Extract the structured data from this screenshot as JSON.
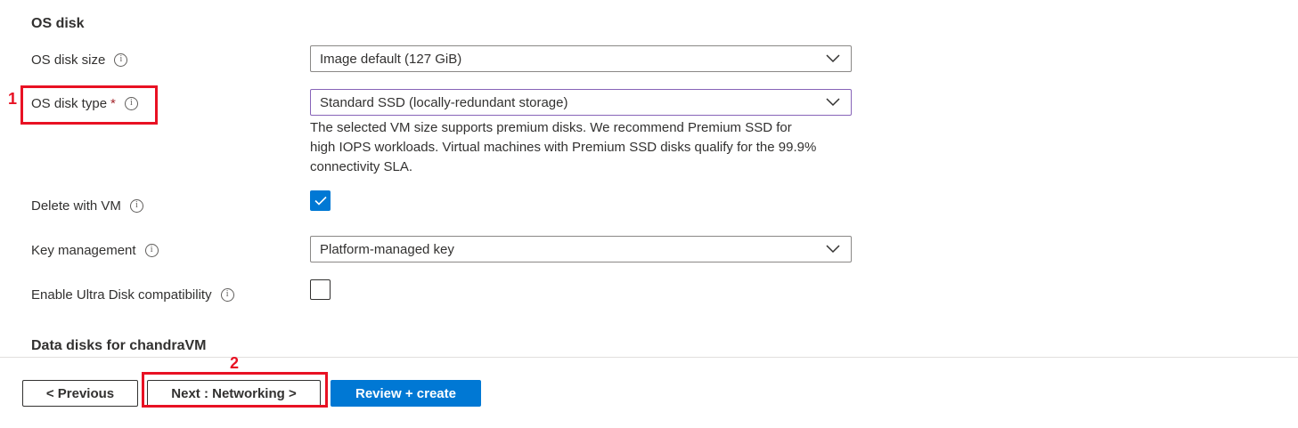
{
  "os_disk": {
    "title": "OS disk",
    "disk_size": {
      "label": "OS disk size",
      "value": "Image default (127 GiB)"
    },
    "disk_type": {
      "label": "OS disk type",
      "required_mark": "*",
      "value": "Standard SSD (locally-redundant storage)",
      "help_line1": "The selected VM size supports premium disks. We recommend Premium SSD for",
      "help_line2": "high IOPS workloads. Virtual machines with Premium SSD disks qualify for the 99.9%",
      "help_line3": "connectivity SLA."
    },
    "delete_with_vm": {
      "label": "Delete with VM",
      "checked": true
    },
    "key_management": {
      "label": "Key management",
      "value": "Platform-managed key"
    },
    "ultra_disk": {
      "label": "Enable Ultra Disk compatibility",
      "checked": false
    }
  },
  "data_disks": {
    "title": "Data disks for chandraVM"
  },
  "footer": {
    "previous_label": "< Previous",
    "next_label": "Next : Networking >",
    "review_label": "Review + create"
  },
  "annotations": {
    "marker1": "1",
    "marker2": "2"
  },
  "colors": {
    "accent": "#0078d4",
    "annotation": "#e81123",
    "focus": "#8764b8"
  },
  "icons": {
    "info": "info-icon",
    "chevron": "chevron-down-icon",
    "check": "checkmark-icon"
  }
}
